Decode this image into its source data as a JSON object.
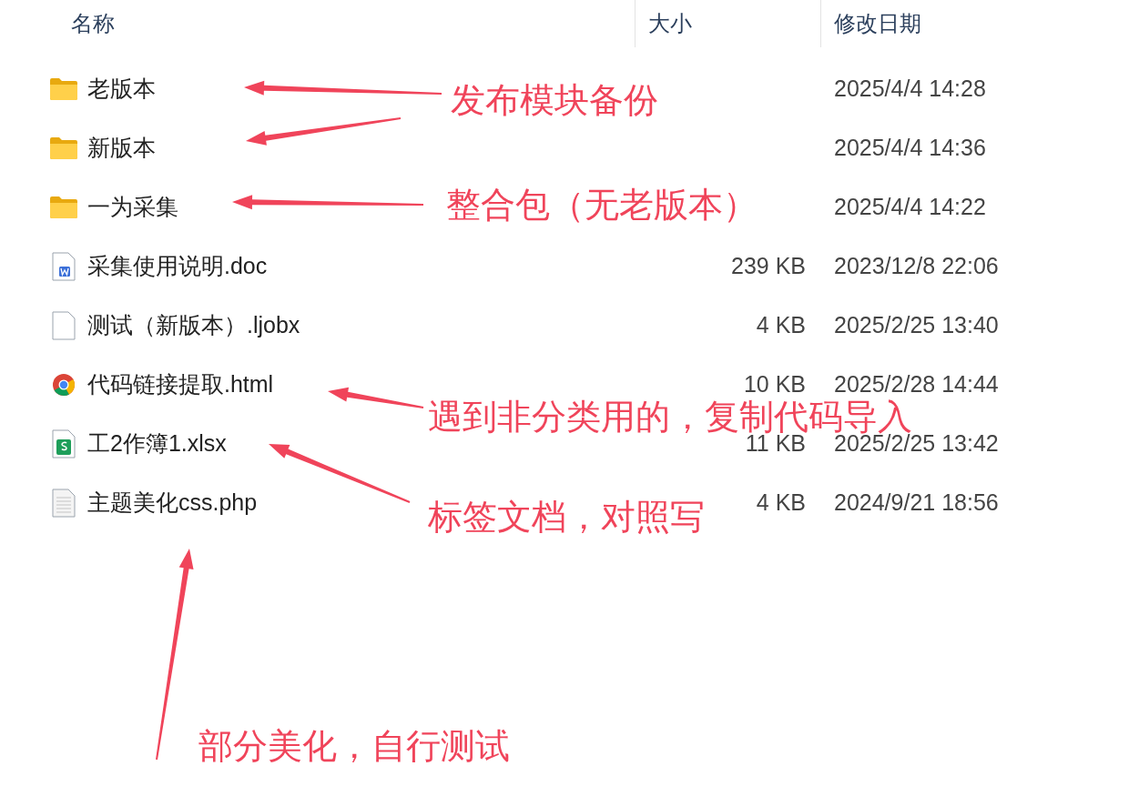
{
  "columns": [
    {
      "label": "名称"
    },
    {
      "label": "大小"
    },
    {
      "label": "修改日期"
    }
  ],
  "rows": [
    {
      "kind": "folder",
      "name": "老版本",
      "size": "",
      "date": "2025/4/4 14:28"
    },
    {
      "kind": "folder",
      "name": "新版本",
      "size": "",
      "date": "2025/4/4 14:36"
    },
    {
      "kind": "folder",
      "name": "一为采集",
      "size": "",
      "date": "2025/4/4 14:22"
    },
    {
      "kind": "word",
      "name": "采集使用说明.doc",
      "size": "239 KB",
      "date": "2023/12/8 22:06"
    },
    {
      "kind": "blank",
      "name": "测试（新版本）.ljobx",
      "size": "4 KB",
      "date": "2025/2/25 13:40"
    },
    {
      "kind": "browser",
      "name": "代码链接提取.html",
      "size": "10 KB",
      "date": "2025/2/28 14:44"
    },
    {
      "kind": "sheet",
      "name": "工2作簿1.xlsx",
      "size": "11 KB",
      "date": "2025/2/25 13:42"
    },
    {
      "kind": "text",
      "name": "主题美化css.php",
      "size": "4 KB",
      "date": "2024/9/21 18:56"
    }
  ],
  "annotations": [
    {
      "text": "发布模块备份"
    },
    {
      "text": "整合包（无老版本）"
    },
    {
      "text": "遇到非分类用的，复制代码导入"
    },
    {
      "text": "标签文档，对照写"
    },
    {
      "text": "部分美化，自行测试"
    }
  ]
}
